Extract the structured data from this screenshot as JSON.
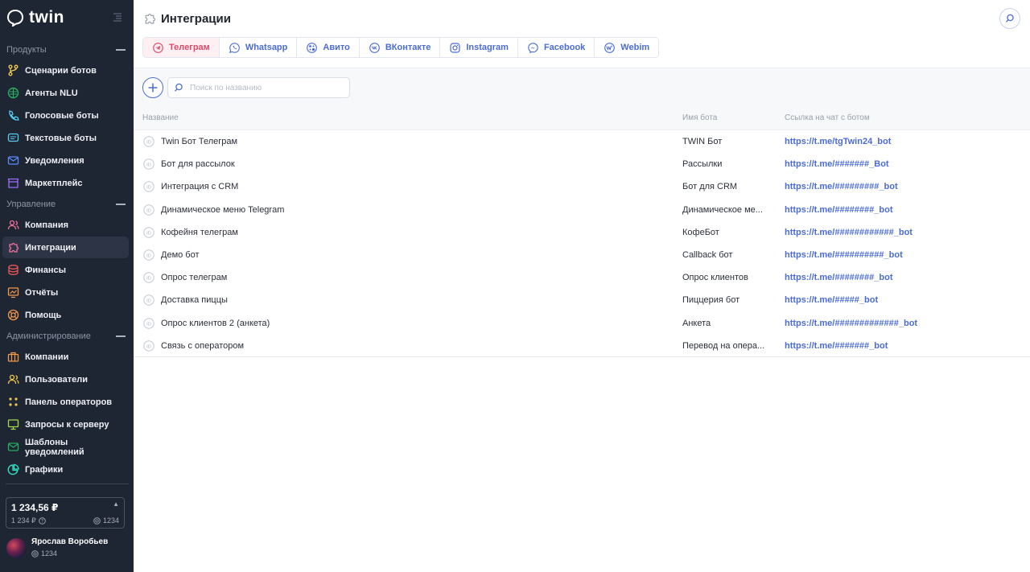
{
  "app": {
    "logo_text": "twin"
  },
  "sidebar": {
    "sections": [
      {
        "label": "Продукты"
      },
      {
        "label": "Управление"
      },
      {
        "label": "Администрирование"
      }
    ],
    "items": [
      {
        "label": "Сценарии ботов",
        "icon": "branch-icon",
        "color": "#f2c94c"
      },
      {
        "label": "Агенты NLU",
        "icon": "brain-icon",
        "color": "#27ae60"
      },
      {
        "label": "Голосовые боты",
        "icon": "phone-icon",
        "color": "#56ccf2"
      },
      {
        "label": "Текстовые боты",
        "icon": "chat-icon",
        "color": "#56ccf2"
      },
      {
        "label": "Уведомления",
        "icon": "mail-icon",
        "color": "#5b8cff"
      },
      {
        "label": "Маркетплейс",
        "icon": "store-icon",
        "color": "#9b6cff"
      },
      {
        "label": "Компания",
        "icon": "users-icon",
        "color": "#f2709c"
      },
      {
        "label": "Интеграции",
        "icon": "puzzle-icon",
        "color": "#f2709c"
      },
      {
        "label": "Финансы",
        "icon": "coins-icon",
        "color": "#eb5757"
      },
      {
        "label": "Отчёты",
        "icon": "report-icon",
        "color": "#f2994a"
      },
      {
        "label": "Помощь",
        "icon": "lifebuoy-icon",
        "color": "#f2994a"
      },
      {
        "label": "Компании",
        "icon": "briefcase-icon",
        "color": "#f2994a"
      },
      {
        "label": "Пользователи",
        "icon": "users-icon",
        "color": "#f2c94c"
      },
      {
        "label": "Панель операторов",
        "icon": "grid-icon",
        "color": "#f2c94c"
      },
      {
        "label": "Запросы к серверу",
        "icon": "monitor-icon",
        "color": "#a3d94c"
      },
      {
        "label": "Шаблоны уведомлений",
        "icon": "mail-icon",
        "color": "#27ae60"
      },
      {
        "label": "Графики",
        "icon": "pie-icon",
        "color": "#2ee6c5"
      }
    ],
    "active_item": "Интеграции",
    "balance": {
      "amount": "1 234,56 ₽",
      "sub": "1 234 ₽",
      "credits": "1234"
    },
    "user": {
      "name": "Ярослав Воробьев",
      "id": "1234"
    }
  },
  "header": {
    "title": "Интеграции"
  },
  "tabs": [
    {
      "label": "Телеграм",
      "icon": "telegram-icon",
      "active": true
    },
    {
      "label": "Whatsapp",
      "icon": "whatsapp-icon"
    },
    {
      "label": "Авито",
      "icon": "avito-icon"
    },
    {
      "label": "ВКонтакте",
      "icon": "vk-icon"
    },
    {
      "label": "Instagram",
      "icon": "instagram-icon"
    },
    {
      "label": "Facebook",
      "icon": "messenger-icon"
    },
    {
      "label": "Webim",
      "icon": "webim-icon"
    }
  ],
  "search": {
    "placeholder": "Поиск по названию",
    "value": ""
  },
  "table": {
    "columns": [
      "Название",
      "Имя бота",
      "Ссылка на чат с ботом"
    ],
    "rows": [
      {
        "name": "Twin Бот Телеграм",
        "bot": "TWIN Бот",
        "link": "https://t.me/tgTwin24_bot"
      },
      {
        "name": "Бот для рассылок",
        "bot": "Рассылки",
        "link": "https://t.me/#######_Bot"
      },
      {
        "name": "Интеграция с CRM",
        "bot": "Бот для CRM",
        "link": "https://t.me/#########_bot"
      },
      {
        "name": "Динамическое меню Telegram",
        "bot": "Динамическое ме...",
        "link": "https://t.me/########_bot"
      },
      {
        "name": "Кофейня телеграм",
        "bot": "КофеБот",
        "link": "https://t.me/############_bot"
      },
      {
        "name": "Демо бот",
        "bot": "Callback бот",
        "link": "https://t.me/##########_bot"
      },
      {
        "name": "Опрос телеграм",
        "bot": "Опрос клиентов",
        "link": "https://t.me/########_bot"
      },
      {
        "name": "Доставка пиццы",
        "bot": "Пиццерия бот",
        "link": "https://t.me/#####_bot"
      },
      {
        "name": "Опрос клиентов 2 (анкета)",
        "bot": "Анкета",
        "link": "https://t.me/#############_bot"
      },
      {
        "name": "Связь с оператором",
        "bot": "Перевод на опера...",
        "link": "https://t.me/#######_bot"
      }
    ]
  },
  "colors": {
    "accent": "#4b6cd6",
    "active_tab": "#e0486a",
    "sidebar_bg": "#1e2533"
  }
}
